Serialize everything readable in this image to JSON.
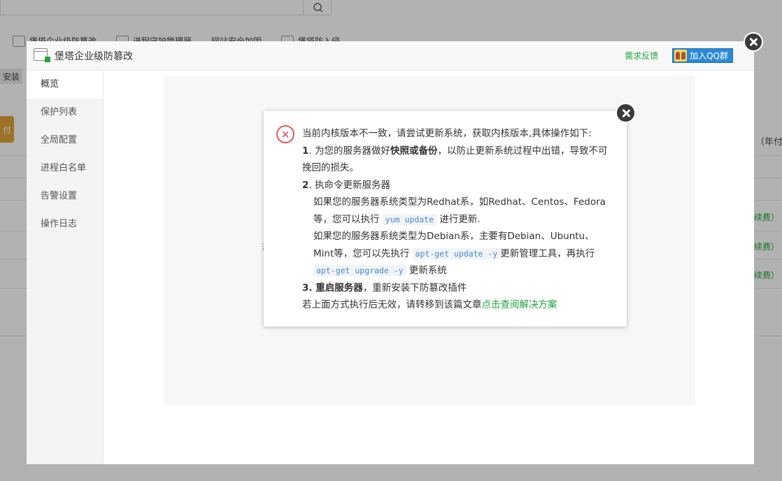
{
  "background": {
    "tabs": [
      "堡塔企业级防篡改",
      "进程守护管理器",
      "网站安全加固",
      "堡塔防入侵"
    ],
    "left_button": "安装",
    "orange_btn": "付",
    "right_text": "（年付",
    "renew": [
      "续费）",
      "续费）",
      "续费）"
    ]
  },
  "plugin": {
    "title": "堡塔企业级防篡改",
    "feedback": "需求反馈",
    "qq_group": "加入QQ群",
    "sidebar": [
      {
        "label": "概览"
      },
      {
        "label": "保护列表"
      },
      {
        "label": "全局配置"
      },
      {
        "label": "进程白名单"
      },
      {
        "label": "告警设置"
      },
      {
        "label": "操作日志"
      }
    ],
    "main_stray": "海"
  },
  "alert": {
    "icon": "error-x-icon",
    "intro": "当前内核版本不一致，请尝试更新系统，获取内核版本,具体操作如下:",
    "step1_num": "1",
    "step1_pre": ". 为您的服务器做好",
    "step1_bold": "快照或备份",
    "step1_post": "，以防止更新系统过程中出错，导致不可挽回的损失。",
    "step2_num": "2",
    "step2_text": ". 执命令更新服务器",
    "redhat_pre": "如果您的服务器系统类型为Redhat系，如Redhat、Centos、Fedora等，您可以执行",
    "redhat_cmd": "yum update",
    "redhat_post": "进行更新.",
    "debian_pre": "如果您的服务器系统类型为Debian系，主要有Debian、Ubuntu、Mint等，您可以先执行",
    "debian_cmd1": "apt-get update -y",
    "debian_mid": "更新管理工具，再执行",
    "debian_cmd2": "apt-get upgrade -y",
    "debian_post": "更新系统",
    "step3_num": "3",
    "step3_bold": ". 重启服务器",
    "step3_post": "，重新安装下防篡改插件",
    "footer_pre": "若上面方式执行后无效，请转移到该篇文章",
    "footer_link": "点击查阅解决方案"
  }
}
